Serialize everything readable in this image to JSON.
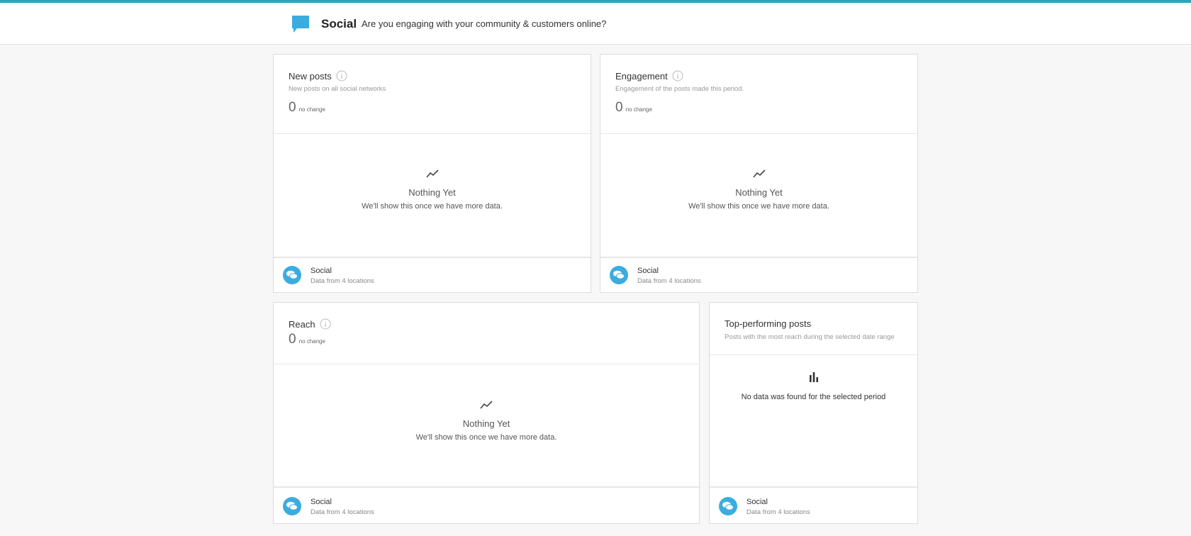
{
  "header": {
    "title": "Social",
    "subtitle": "Are you engaging with your community & customers online?",
    "icon": "speech-bubble-icon",
    "accent": "#2aa5bd"
  },
  "cards": {
    "new_posts": {
      "title": "New posts",
      "description": "New posts on all social networks",
      "value": "0",
      "change": "no change",
      "empty_title": "Nothing Yet",
      "empty_sub": "We'll show this once we have more data.",
      "source_name": "Social",
      "source_sub": "Data from 4 locations"
    },
    "engagement": {
      "title": "Engagement",
      "description": "Engagement of the posts made this period.",
      "value": "0",
      "change": "no change",
      "empty_title": "Nothing Yet",
      "empty_sub": "We'll show this once we have more data.",
      "source_name": "Social",
      "source_sub": "Data from 4 locations"
    },
    "reach": {
      "title": "Reach",
      "value": "0",
      "change": "no change",
      "empty_title": "Nothing Yet",
      "empty_sub": "We'll show this once we have more data.",
      "source_name": "Social",
      "source_sub": "Data from 4 locations"
    },
    "top_posts": {
      "title": "Top-performing posts",
      "description": "Posts with the most reach during the selected date range",
      "empty_text": "No data was found for the selected period",
      "source_name": "Social",
      "source_sub": "Data from 4 locations"
    }
  },
  "colors": {
    "source_icon": "#3aace0",
    "header_icon": "#3aace0"
  }
}
